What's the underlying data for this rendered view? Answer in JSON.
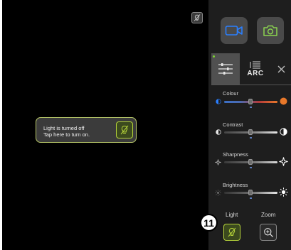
{
  "viewer": {
    "light_message": {
      "line1": "Light is turned off",
      "line2": "Tap here to turn on."
    }
  },
  "capture": {
    "video_icon": "video-camera-icon",
    "photo_icon": "photo-camera-icon"
  },
  "tabs": {
    "filters_icon": "sliders-icon",
    "arc_label": "ARC",
    "close_icon": "close-icon"
  },
  "sliders": [
    {
      "label": "Colour",
      "left_icon": "blue-dot-icon",
      "right_icon": "orange-dot-icon",
      "level": 0.5
    },
    {
      "label": "Contrast",
      "left_icon": "contrast-low-icon",
      "right_icon": "contrast-high-icon",
      "level": 0.5
    },
    {
      "label": "Sharpness",
      "left_icon": "sparkle-small-icon",
      "right_icon": "sparkle-large-icon",
      "level": 0.5
    },
    {
      "label": "Brightness",
      "left_icon": "sun-dim-icon",
      "right_icon": "sun-bright-icon",
      "level": 0.5
    }
  ],
  "bottom": {
    "light_label": "Light",
    "zoom_label": "Zoom"
  },
  "callout": {
    "number": "11"
  },
  "colors": {
    "accent_green": "#b6d43a",
    "capture_blue": "#2a7fff",
    "capture_green": "#8bd450",
    "orange": "#e8782a"
  }
}
